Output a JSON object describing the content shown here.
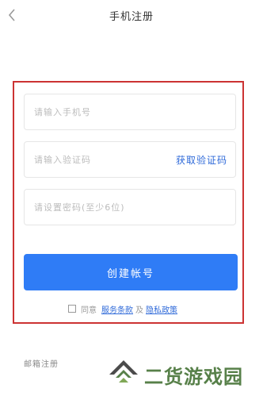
{
  "header": {
    "title": "手机注册",
    "back_icon": "chevron-left-icon"
  },
  "form": {
    "phone_placeholder": "请输入手机号",
    "code_placeholder": "请输入验证码",
    "get_code_label": "获取验证码",
    "password_placeholder": "请设置密码(至少6位)",
    "submit_label": "创建帐号",
    "agree_prefix": "同意",
    "terms_label": "服务条款",
    "agree_and": "及",
    "privacy_label": "隐私政策"
  },
  "footer": {
    "email_register_label": "邮箱注册"
  },
  "watermark": {
    "text": "二货游戏园"
  },
  "colors": {
    "accent": "#2f7cf6",
    "link": "#2f6ad9",
    "highlight_border": "#cc3333"
  }
}
